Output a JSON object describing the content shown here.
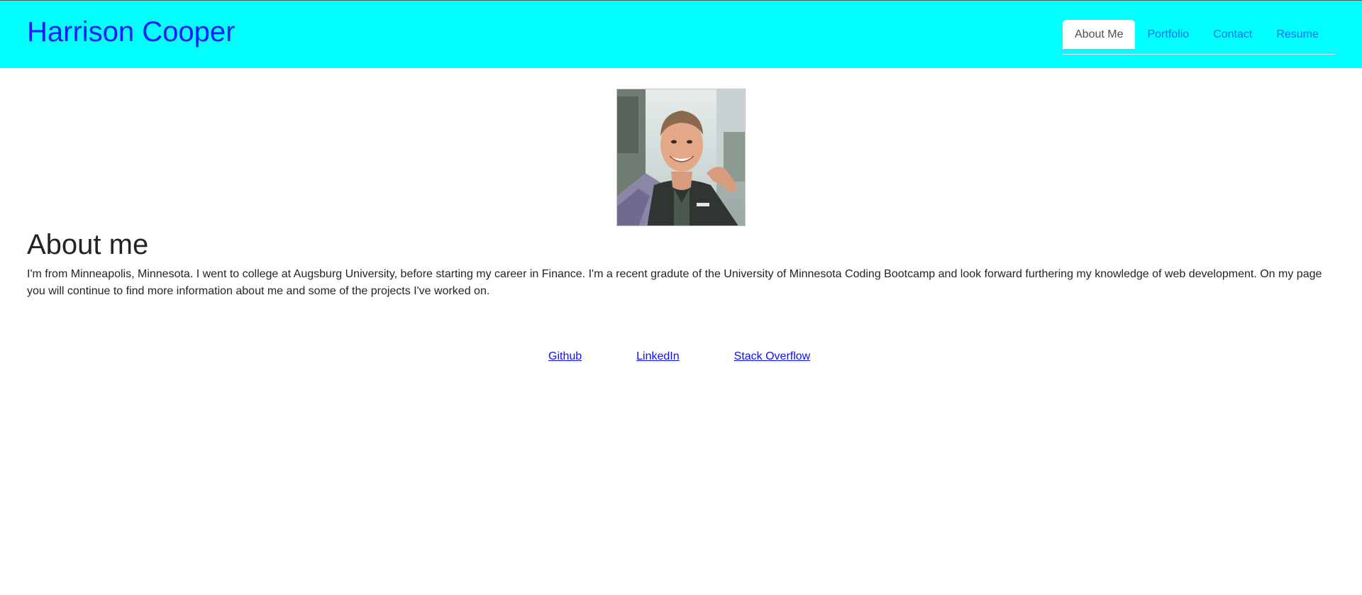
{
  "header": {
    "title": "Harrison Cooper",
    "background": "#00ffff",
    "title_color": "#1a1aff"
  },
  "nav": {
    "tabs": [
      {
        "label": "About Me",
        "active": true
      },
      {
        "label": "Portfolio",
        "active": false
      },
      {
        "label": "Contact",
        "active": false
      },
      {
        "label": "Resume",
        "active": false
      }
    ]
  },
  "main": {
    "avatar_icon": "profile-photo",
    "heading": "About me",
    "paragraph": "I'm from Minneapolis, Minnesota. I went to college at Augsburg University, before starting my career in Finance. I'm a recent gradute of the University of Minnesota Coding Bootcamp and look forward furthering my knowledge of web development. On my page you will continue to find more information about me and some of the projects I've worked on."
  },
  "footer": {
    "links": [
      {
        "label": "Github"
      },
      {
        "label": "LinkedIn"
      },
      {
        "label": "Stack Overflow"
      }
    ]
  }
}
